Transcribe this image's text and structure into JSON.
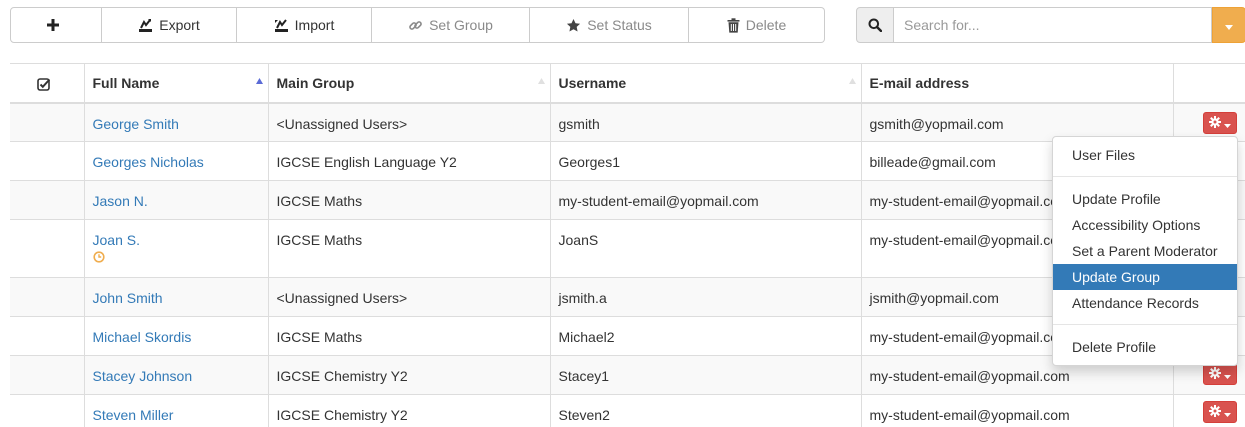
{
  "toolbar": {
    "add_label": "",
    "export_label": "Export",
    "import_label": "Import",
    "set_group_label": "Set Group",
    "set_status_label": "Set Status",
    "delete_label": "Delete"
  },
  "search": {
    "placeholder": "Search for...",
    "value": ""
  },
  "table": {
    "columns": [
      "Full Name",
      "Main Group",
      "Username",
      "E-mail address"
    ],
    "rows": [
      {
        "name": "George Smith",
        "group": "<Unassigned Users>",
        "username": "gsmith",
        "email": "gsmith@yopmail.com"
      },
      {
        "name": "Georges Nicholas",
        "group": "IGCSE English Language Y2",
        "username": "Georges1",
        "email": "billeade@gmail.com"
      },
      {
        "name": "Jason N.",
        "group": "IGCSE Maths",
        "username": "my-student-email@yopmail.com",
        "email": "my-student-email@yopmail.com"
      },
      {
        "name": "Joan S.",
        "group": "IGCSE Maths",
        "username": "JoanS",
        "email": "my-student-email@yopmail.com",
        "pending": true
      },
      {
        "name": "John Smith",
        "group": "<Unassigned Users>",
        "username": "jsmith.a",
        "email": "jsmith@yopmail.com"
      },
      {
        "name": "Michael Skordis",
        "group": "IGCSE Maths",
        "username": "Michael2",
        "email": "my-student-email@yopmail.com"
      },
      {
        "name": "Stacey Johnson",
        "group": "IGCSE Chemistry Y2",
        "username": "Stacey1",
        "email": "my-student-email@yopmail.com"
      },
      {
        "name": "Steven Miller",
        "group": "IGCSE Chemistry Y2",
        "username": "Steven2",
        "email": "my-student-email@yopmail.com"
      }
    ]
  },
  "menu": {
    "items": [
      "User Files",
      "Update Profile",
      "Accessibility Options",
      "Set a Parent Moderator",
      "Update Group",
      "Attendance Records",
      "Delete Profile"
    ],
    "active": "Update Group"
  },
  "icons": {
    "add": "plus-icon",
    "export": "export-icon",
    "import": "import-icon",
    "set_group": "link-icon",
    "set_status": "star-icon",
    "delete": "trash-icon",
    "search": "search-icon",
    "caret": "chevron-down-icon",
    "select_all": "check-square-icon",
    "sort": "sort-triangle-icon",
    "pending": "clock-icon",
    "row_action": "gear-icon"
  },
  "colors": {
    "link": "#337ab7",
    "danger": "#d9534f",
    "warning": "#f0ad4e",
    "active_item": "#337ab7",
    "clock": "#f0ad4e"
  }
}
